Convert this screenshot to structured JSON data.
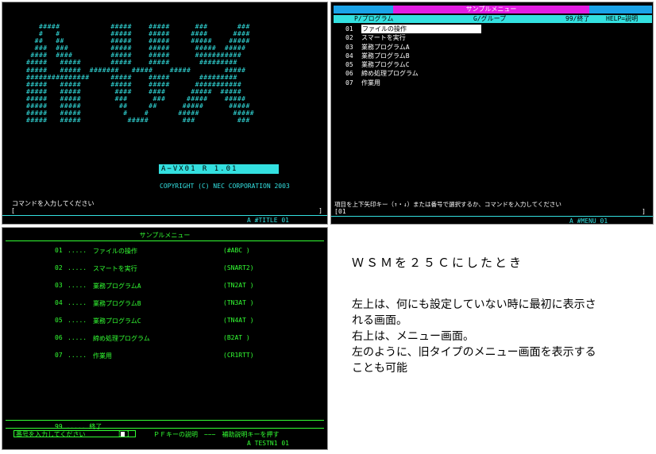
{
  "screen1": {
    "logo_lines": [
      "   #####            #####    #####      ###       ###",
      "   #   #            #####    #####     ####      ####",
      "  ##   ##           #####    #####     #####    #####",
      "  ###  ###          #####    #####      #####  #####",
      " ####  ####         #####    #####      ###########",
      "#####   #####       #####    #####       #########",
      "#####   #####  #######   #####    #####        #####",
      "###############     #####    #####       #########",
      "#####   #####       #####    #####      ###########",
      "#####   #####        ####    ####      #####  #####",
      "#####   #####        ###      ###     #####    #####",
      "#####   #####         ##     ##      #####      #####",
      "#####   #####          #    #       #####        #####",
      "#####   #####           #####        ###          ###"
    ],
    "version": "A−VX01   R 1.01",
    "copyright": "COPYRIGHT (C) NEC CORPORATION 2003",
    "prompt": "コマンドを入力してください",
    "cmd_left_bracket": "[",
    "cmd_right_bracket": "]",
    "screen_id": "A #TITLE 01"
  },
  "screen2": {
    "title": "サンプルメニュー",
    "header": {
      "program": "P/プログラム",
      "group": "G/グループ",
      "exit": "99/終了",
      "help": "HELP=説明"
    },
    "menu_items": [
      {
        "num": "01",
        "label": "ファイルの操作"
      },
      {
        "num": "02",
        "label": "スマートを実行"
      },
      {
        "num": "03",
        "label": "業務プログラムA"
      },
      {
        "num": "04",
        "label": "業務プログラムB"
      },
      {
        "num": "05",
        "label": "業務プログラムC"
      },
      {
        "num": "06",
        "label": "締め処理プログラム"
      },
      {
        "num": "07",
        "label": "作業用"
      }
    ],
    "instruction": "項目を上下矢印キー（↑・↓）または番号で選択するか、コマンドを入力してください",
    "input_left_bracket": "[",
    "input_value": "01",
    "input_right_bracket": "]",
    "screen_id": "A #MENU  01"
  },
  "screen3": {
    "title": "サンプルメニュー",
    "items": [
      {
        "num": "01",
        "dots": ".....",
        "label": "ファイルの操作",
        "code": "(#ABC  )"
      },
      {
        "num": "02",
        "dots": ".....",
        "label": "スマートを実行",
        "code": "(SNART2)"
      },
      {
        "num": "03",
        "dots": ".....",
        "label": "業務プログラムA",
        "code": "(TN2AT )"
      },
      {
        "num": "04",
        "dots": ".....",
        "label": "業務プログラムB",
        "code": "(TN3AT )"
      },
      {
        "num": "05",
        "dots": ".....",
        "label": "業務プログラムC",
        "code": "(TN4AT )"
      },
      {
        "num": "06",
        "dots": ".....",
        "label": "締め処理プログラム",
        "code": "(B2AT  )"
      },
      {
        "num": "07",
        "dots": ".....",
        "label": "作業用",
        "code": "(CR1RTT)"
      }
    ],
    "exit_item": "99 ..... 終了",
    "input_label": "番号を入力してください",
    "input_bracket_left": "[",
    "input_bracket_right": "]",
    "pf_hint": "ＰＦキーの説明　−−−　補助説明キーを押す",
    "screen_id": "A TESTN1 01"
  },
  "notes": {
    "title": "ＷＳＭを２５Ｃにしたとき",
    "lines": [
      "左上は、何にも設定していない時に最初に表示さ",
      "れる画面。",
      "右上は、メニュー画面。",
      "左のように、旧タイプのメニュー画面を表示する",
      "ことも可能"
    ]
  },
  "colors": {
    "cyan": "#33e0e0",
    "green": "#33ff33",
    "magenta": "#e21ce2",
    "blue": "#1aa3e8",
    "terminal_bg": "#000000"
  }
}
